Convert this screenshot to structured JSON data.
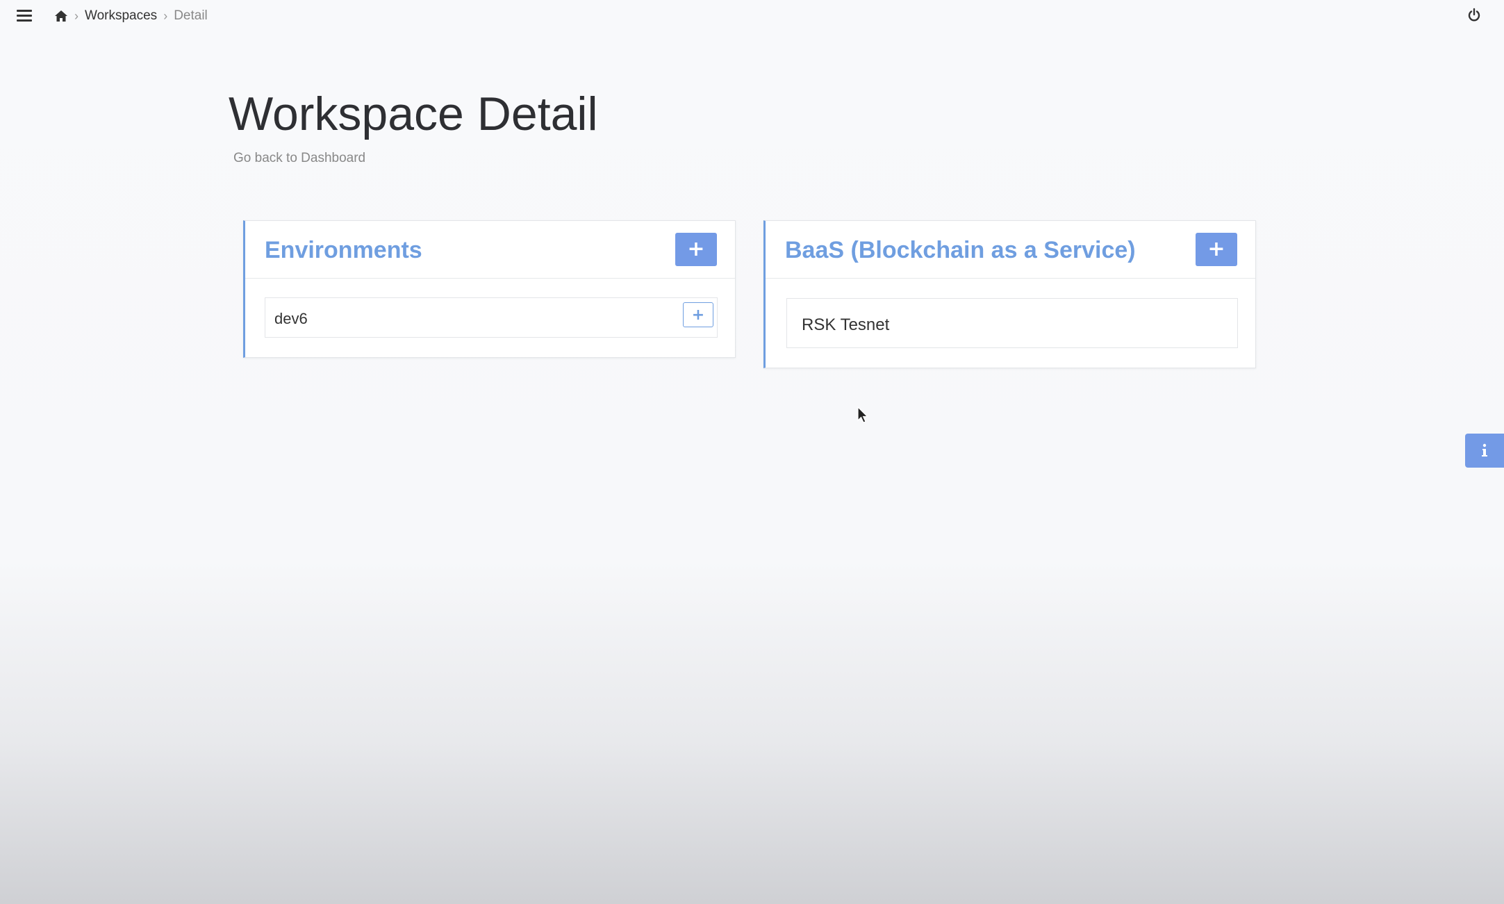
{
  "breadcrumb": {
    "home_icon": "home-icon",
    "workspaces": "Workspaces",
    "current": "Detail"
  },
  "page": {
    "title": "Workspace Detail",
    "back_link": "Go back to Dashboard"
  },
  "environments": {
    "title": "Environments",
    "add_label": "+",
    "items": [
      {
        "label": "dev6",
        "add_label": "+"
      }
    ]
  },
  "baas": {
    "title": "BaaS (Blockchain as a Service)",
    "add_label": "+",
    "items": [
      {
        "label": "RSK Tesnet"
      }
    ]
  },
  "icons": {
    "menu": "hamburger-menu-icon",
    "power": "power-icon",
    "info": "info-icon"
  },
  "colors": {
    "accent": "#6f9ee0",
    "button": "#739ae6",
    "title_text": "#2e2f33"
  }
}
